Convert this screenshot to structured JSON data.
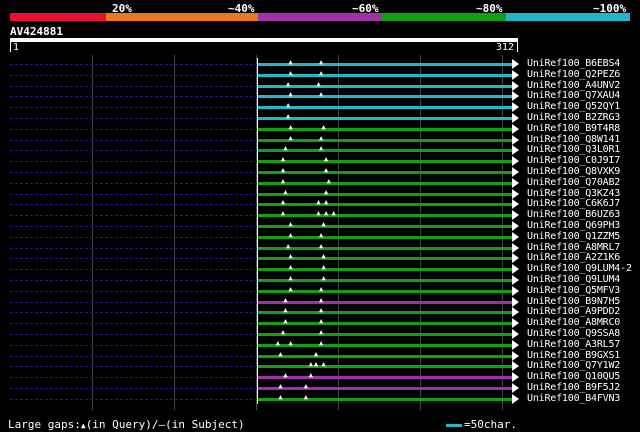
{
  "scale": {
    "labels": [
      "20%",
      "~40%",
      "~60%",
      "~80%",
      "~100%"
    ],
    "colors": [
      "#e8102a",
      "#e87820",
      "#a030a8",
      "#10a010",
      "#20b8c8"
    ]
  },
  "query": {
    "name": "AV424881",
    "start": "1",
    "end": "312"
  },
  "hits": [
    {
      "name": "UniRef100_B6EBS4",
      "color": "#20b8c8",
      "gaps": [
        0.12,
        0.24
      ]
    },
    {
      "name": "UniRef100_Q2PEZ6",
      "color": "#20b8c8",
      "gaps": [
        0.12,
        0.24
      ]
    },
    {
      "name": "UniRef100_A4UNV2",
      "color": "#20b8c8",
      "gaps": [
        0.11,
        0.23
      ]
    },
    {
      "name": "UniRef100_Q7XAU4",
      "color": "#20b8c8",
      "gaps": [
        0.12,
        0.24
      ]
    },
    {
      "name": "UniRef100_Q52QY1",
      "color": "#20b8c8",
      "gaps": [
        0.11
      ]
    },
    {
      "name": "UniRef100_B2ZRG3",
      "color": "#20b8c8",
      "gaps": [
        0.11
      ]
    },
    {
      "name": "UniRef100_B9T4R8",
      "color": "#10a010",
      "gaps": [
        0.12,
        0.25
      ]
    },
    {
      "name": "UniRef100_Q8W141",
      "color": "#10a010",
      "gaps": [
        0.12,
        0.24
      ]
    },
    {
      "name": "UniRef100_Q3L0R1",
      "color": "#10a010",
      "gaps": [
        0.1,
        0.24
      ]
    },
    {
      "name": "UniRef100_C0J9I7",
      "color": "#10a010",
      "gaps": [
        0.09,
        0.26
      ]
    },
    {
      "name": "UniRef100_Q8VXK9",
      "color": "#10a010",
      "gaps": [
        0.09,
        0.26
      ]
    },
    {
      "name": "UniRef100_Q70AB2",
      "color": "#10a010",
      "gaps": [
        0.09,
        0.27
      ]
    },
    {
      "name": "UniRef100_Q3KZ43",
      "color": "#10a010",
      "gaps": [
        0.1,
        0.26
      ]
    },
    {
      "name": "UniRef100_C6K6J7",
      "color": "#10a010",
      "gaps": [
        0.09,
        0.23,
        0.26
      ]
    },
    {
      "name": "UniRef100_B6UZ63",
      "color": "#10a010",
      "gaps": [
        0.09,
        0.23,
        0.26,
        0.29
      ]
    },
    {
      "name": "UniRef100_Q69PH3",
      "color": "#10a010",
      "gaps": [
        0.12,
        0.25
      ]
    },
    {
      "name": "UniRef100_Q1ZZM5",
      "color": "#10a010",
      "gaps": [
        0.12,
        0.24
      ]
    },
    {
      "name": "UniRef100_A8MRL7",
      "color": "#10a010",
      "gaps": [
        0.11,
        0.24
      ]
    },
    {
      "name": "UniRef100_A2Z1K6",
      "color": "#10a010",
      "gaps": [
        0.12,
        0.25
      ]
    },
    {
      "name": "UniRef100_Q9LUM4-2",
      "color": "#10a010",
      "gaps": [
        0.12,
        0.25
      ]
    },
    {
      "name": "UniRef100_Q9LUM4",
      "color": "#10a010",
      "gaps": [
        0.12,
        0.25
      ]
    },
    {
      "name": "UniRef100_Q5MFV3",
      "color": "#10a010",
      "gaps": [
        0.12,
        0.24
      ]
    },
    {
      "name": "UniRef100_B9N7H5",
      "color": "#a030a8",
      "gaps": [
        0.1,
        0.24
      ]
    },
    {
      "name": "UniRef100_A9PDD2",
      "color": "#10a010",
      "gaps": [
        0.1,
        0.24
      ]
    },
    {
      "name": "UniRef100_A8MRC0",
      "color": "#10a010",
      "gaps": [
        0.1,
        0.24
      ]
    },
    {
      "name": "UniRef100_Q9SSA8",
      "color": "#10a010",
      "gaps": [
        0.09,
        0.24
      ]
    },
    {
      "name": "UniRef100_A3RL57",
      "color": "#10a010",
      "gaps": [
        0.07,
        0.12,
        0.24
      ]
    },
    {
      "name": "UniRef100_B9GXS1",
      "color": "#10a010",
      "gaps": [
        0.08,
        0.22
      ]
    },
    {
      "name": "UniRef100_Q7Y1W2",
      "color": "#10a010",
      "gaps": [
        0.2,
        0.22,
        0.25
      ]
    },
    {
      "name": "UniRef100_Q10QU5",
      "color": "#a030a8",
      "gaps": [
        0.1,
        0.2
      ]
    },
    {
      "name": "UniRef100_B9F5J2",
      "color": "#a030a8",
      "gaps": [
        0.08,
        0.18
      ]
    },
    {
      "name": "UniRef100_B4FVN3",
      "color": "#10a010",
      "gaps": [
        0.08,
        0.18
      ]
    }
  ],
  "footer": {
    "large_gaps": "Large gaps:",
    "gap_glyph": "▲",
    "in_query": "(in Query)/",
    "subj_glyph": "–",
    "in_subject": "(in Subject)"
  },
  "legend": {
    "text": "=50char.",
    "color": "#20b8c8"
  }
}
